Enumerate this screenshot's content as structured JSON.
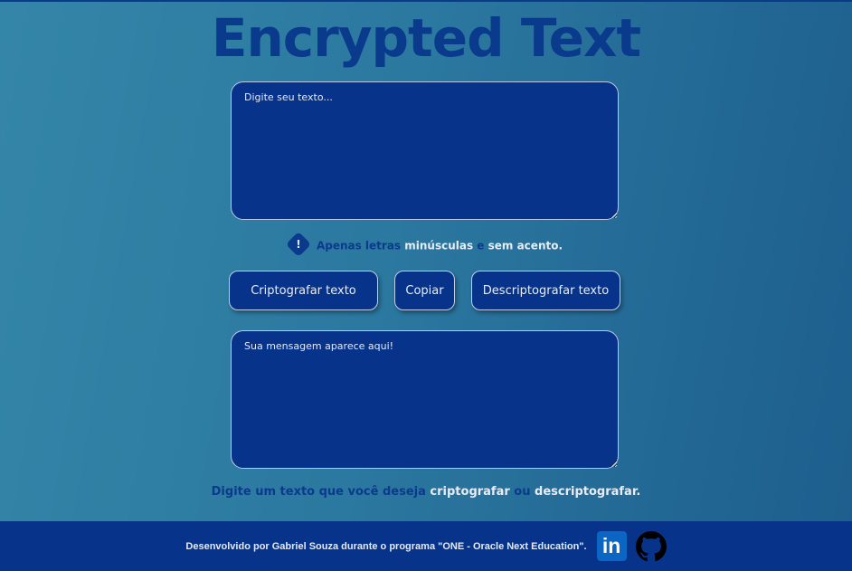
{
  "header": {
    "title": "Encrypted Text"
  },
  "input": {
    "placeholder": "Digite seu texto..."
  },
  "hint": {
    "icon": "exclamation-icon",
    "part1": "Apenas letras ",
    "part2": "minúsculas",
    "part3": " e ",
    "part4": "sem acento."
  },
  "buttons": {
    "encrypt": "Criptografar texto",
    "copy": "Copiar",
    "decrypt": "Descriptografar texto"
  },
  "output": {
    "placeholder": "Sua mensagem aparece aqui!"
  },
  "tip": {
    "part1": "Digite um texto que você deseja ",
    "part2": "criptografar",
    "part3": " ou ",
    "part4": "descriptografar."
  },
  "footer": {
    "credit": "Desenvolvido por Gabriel Souza durante o programa \"ONE - Oracle Next Education\".",
    "linkedin_icon": "linkedin-icon",
    "linkedin_text": "in",
    "github_icon": "github-icon"
  },
  "colors": {
    "accent": "#07348a",
    "title": "#0a3a8c",
    "highlight": "#e7ecf6",
    "linkedin": "#0a66c2"
  }
}
